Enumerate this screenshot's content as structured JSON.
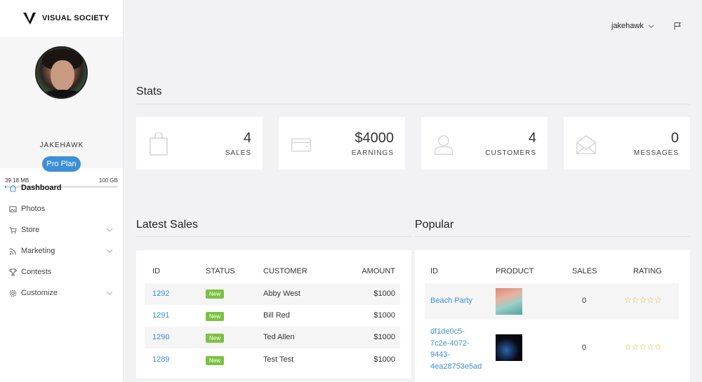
{
  "brand": {
    "name": "VISUAL SOCIETY"
  },
  "profile": {
    "username": "JAKEHAWK",
    "plan_label": "Pro Plan",
    "storage_used": "39.18 MB",
    "storage_total": "100 GB",
    "storage_fraction": 0.0004
  },
  "nav": {
    "items": [
      {
        "label": "Dashboard",
        "icon": "home-icon",
        "active": true
      },
      {
        "label": "Photos",
        "icon": "image-icon"
      },
      {
        "label": "Store",
        "icon": "cart-icon",
        "expandable": true
      },
      {
        "label": "Marketing",
        "icon": "rss-icon",
        "expandable": true
      },
      {
        "label": "Contests",
        "icon": "trophy-icon"
      },
      {
        "label": "Customize",
        "icon": "gear-icon",
        "expandable": true
      }
    ]
  },
  "header": {
    "user": "jakehawk",
    "flag_icon": "flag-icon"
  },
  "stats": {
    "title": "Stats",
    "cards": [
      {
        "value": "4",
        "label": "SALES",
        "icon": "shopping-bag-icon"
      },
      {
        "value": "$4000",
        "label": "EARNINGS",
        "icon": "wallet-icon"
      },
      {
        "value": "4",
        "label": "CUSTOMERS",
        "icon": "user-icon"
      },
      {
        "value": "0",
        "label": "MESSAGES",
        "icon": "envelope-icon"
      }
    ]
  },
  "latest_sales": {
    "title": "Latest Sales",
    "columns": [
      "ID",
      "STATUS",
      "CUSTOMER",
      "AMOUNT"
    ],
    "rows": [
      {
        "id": "1292",
        "status": "New",
        "customer": "Abby West",
        "amount": "$1000"
      },
      {
        "id": "1291",
        "status": "New",
        "customer": "Bill Red",
        "amount": "$1000"
      },
      {
        "id": "1290",
        "status": "New",
        "customer": "Ted Allen",
        "amount": "$1000"
      },
      {
        "id": "1289",
        "status": "New",
        "customer": "Test Test",
        "amount": "$1000"
      }
    ]
  },
  "popular": {
    "title": "Popular",
    "columns": [
      "ID",
      "PRODUCT",
      "SALES",
      "RATING"
    ],
    "rows": [
      {
        "id_lines": [
          "Beach Party"
        ],
        "sales": "0",
        "rating": "☆☆☆☆☆",
        "rating_value": 0
      },
      {
        "id_lines": [
          "df1de0c5-",
          "7c2e-4072-",
          "9443-",
          "4ea28753e5ad"
        ],
        "sales": "0",
        "rating": "☆☆☆☆☆",
        "rating_value": 0
      }
    ]
  },
  "colors": {
    "accent": "#3d8fd6",
    "badge": "#7cc242",
    "star": "#e8b830"
  }
}
